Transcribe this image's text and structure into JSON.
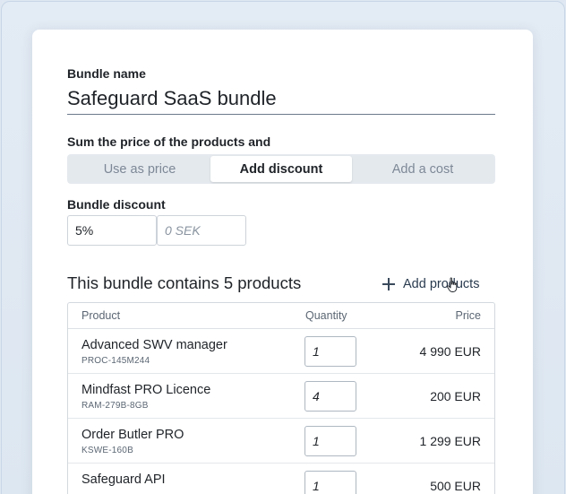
{
  "bundle": {
    "name_label": "Bundle name",
    "name_value": "Safeguard SaaS bundle"
  },
  "pricing": {
    "label": "Sum the price of the products and",
    "options": [
      {
        "label": "Use as price",
        "active": false
      },
      {
        "label": "Add discount",
        "active": true
      },
      {
        "label": "Add a cost",
        "active": false
      }
    ]
  },
  "discount": {
    "label": "Bundle discount",
    "percent_value": "5%",
    "amount_placeholder": "0 SEK"
  },
  "products": {
    "title": "This bundle contains 5 products",
    "add_label": "Add products",
    "columns": {
      "product": "Product",
      "quantity": "Quantity",
      "price": "Price"
    },
    "rows": [
      {
        "name": "Advanced SWV manager",
        "sku": "PROC-145M244",
        "quantity": "1",
        "price": "4 990 EUR"
      },
      {
        "name": "Mindfast PRO Licence",
        "sku": "RAM-279B-8GB",
        "quantity": "4",
        "price": "200 EUR"
      },
      {
        "name": "Order Butler PRO",
        "sku": "KSWE-160B",
        "quantity": "1",
        "price": "1 299 EUR"
      },
      {
        "name": "Safeguard API",
        "sku": "",
        "quantity": "1",
        "price": "500 EUR"
      }
    ]
  },
  "icons": {
    "add": "plus-icon",
    "cursor": "hand-pointer-icon"
  }
}
